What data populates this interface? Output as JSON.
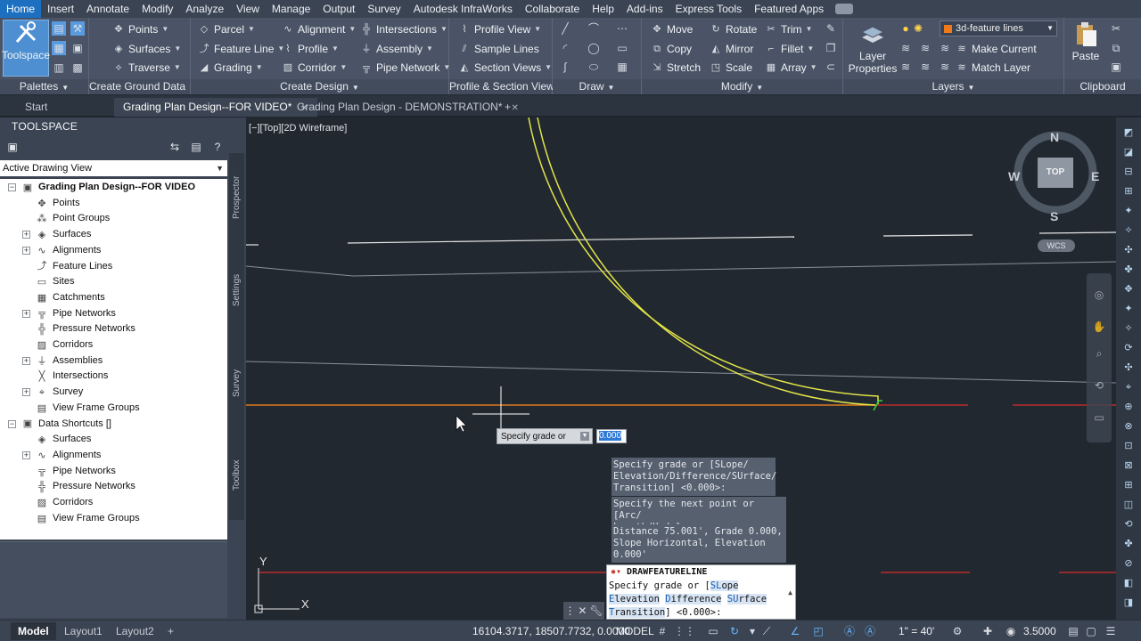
{
  "ribbon": {
    "tabs": [
      "Home",
      "Insert",
      "Annotate",
      "Modify",
      "Analyze",
      "View",
      "Manage",
      "Output",
      "Survey",
      "Autodesk InfraWorks",
      "Collaborate",
      "Help",
      "Add-ins",
      "Express Tools",
      "Featured Apps"
    ],
    "active_tab": "Home",
    "toolspace_label": "Toolspace",
    "panels": {
      "palettes": "Palettes",
      "create_ground_data": "Create Ground Data",
      "create_design": "Create Design",
      "profile_section_views": "Profile & Section Views",
      "draw": "Draw",
      "modify": "Modify",
      "layers": "Layers",
      "clipboard": "Clipboard"
    },
    "ground": {
      "points": "Points",
      "surfaces": "Surfaces",
      "traverse": "Traverse"
    },
    "design": {
      "parcel": "Parcel",
      "feature_line": "Feature Line",
      "grading": "Grading",
      "alignment": "Alignment",
      "profile": "Profile",
      "corridor": "Corridor",
      "intersections": "Intersections",
      "assembly": "Assembly",
      "pipe_network": "Pipe Network"
    },
    "views": {
      "profile_view": "Profile View",
      "sample_lines": "Sample Lines",
      "section_views": "Section Views"
    },
    "modify": {
      "move": "Move",
      "copy": "Copy",
      "stretch": "Stretch",
      "rotate": "Rotate",
      "mirror": "Mirror",
      "scale": "Scale",
      "trim": "Trim",
      "fillet": "Fillet",
      "array": "Array"
    },
    "layers": {
      "properties_line1": "Layer",
      "properties_line2": "Properties",
      "current_layer": "3d-feature lines",
      "make_current": "Make Current",
      "match_layer": "Match Layer"
    },
    "clipboard": {
      "paste": "Paste"
    }
  },
  "doc_tabs": {
    "start": "Start",
    "tabs": [
      {
        "label": "Grading Plan Design--FOR VIDEO*",
        "active": true
      },
      {
        "label": "Grading Plan Design - DEMONSTRATION*",
        "active": false
      }
    ],
    "new_tab": "+"
  },
  "toolspace": {
    "title": "TOOLSPACE",
    "view_select": "Active Drawing View",
    "tree": [
      {
        "label": "Grading Plan Design--FOR VIDEO",
        "level": 0,
        "root": true,
        "expanded": true,
        "icon": "drawing-icon"
      },
      {
        "label": "Points",
        "level": 1,
        "icon": "points-icon"
      },
      {
        "label": "Point Groups",
        "level": 1,
        "icon": "point-groups-icon"
      },
      {
        "label": "Surfaces",
        "level": 1,
        "expandable": true,
        "icon": "surfaces-icon"
      },
      {
        "label": "Alignments",
        "level": 1,
        "expandable": true,
        "icon": "alignments-icon"
      },
      {
        "label": "Feature Lines",
        "level": 1,
        "icon": "feature-lines-icon"
      },
      {
        "label": "Sites",
        "level": 1,
        "icon": "sites-icon"
      },
      {
        "label": "Catchments",
        "level": 1,
        "icon": "catchments-icon"
      },
      {
        "label": "Pipe Networks",
        "level": 1,
        "expandable": true,
        "icon": "pipe-networks-icon"
      },
      {
        "label": "Pressure Networks",
        "level": 1,
        "icon": "pressure-networks-icon"
      },
      {
        "label": "Corridors",
        "level": 1,
        "icon": "corridors-icon"
      },
      {
        "label": "Assemblies",
        "level": 1,
        "expandable": true,
        "icon": "assemblies-icon"
      },
      {
        "label": "Intersections",
        "level": 1,
        "icon": "intersections-icon"
      },
      {
        "label": "Survey",
        "level": 1,
        "expandable": true,
        "icon": "survey-icon"
      },
      {
        "label": "View Frame Groups",
        "level": 1,
        "icon": "view-frame-groups-icon"
      },
      {
        "label": "Data Shortcuts []",
        "level": 0,
        "root": false,
        "expanded": true,
        "icon": "data-shortcuts-icon"
      },
      {
        "label": "Surfaces",
        "level": 1,
        "icon": "surfaces-icon"
      },
      {
        "label": "Alignments",
        "level": 1,
        "expandable": true,
        "icon": "alignments-icon"
      },
      {
        "label": "Pipe Networks",
        "level": 1,
        "icon": "pipe-networks-icon"
      },
      {
        "label": "Pressure Networks",
        "level": 1,
        "icon": "pressure-networks-icon"
      },
      {
        "label": "Corridors",
        "level": 1,
        "icon": "corridors-icon"
      },
      {
        "label": "View Frame Groups",
        "level": 1,
        "icon": "view-frame-groups-icon"
      }
    ],
    "side_tabs": [
      "Prospector",
      "Settings",
      "Survey",
      "Toolbox"
    ]
  },
  "viewport": {
    "label": "[−][Top][2D Wireframe]",
    "compass": {
      "n": "N",
      "s": "S",
      "e": "E",
      "w": "W",
      "cube": "TOP"
    },
    "wcs": "WCS",
    "ucs": {
      "x": "X",
      "y": "Y"
    },
    "dynamic_input": {
      "prompt": "Specify grade or",
      "value": "0.000"
    },
    "history": [
      "Specify grade or [SLope/\nElevation/Difference/SUrface/\nTransition] <0.000>:",
      "Specify the next point or [Arc/\nLength/Undo]:",
      "Distance 75.001',  Grade 0.000,\nSlope Horizontal,  Elevation\n0.000'"
    ],
    "command_line": {
      "command": "DRAWFEATURELINE",
      "line1": "Specify grade or [",
      "opt_slope": "SL",
      "opt_slope_rest": "ope",
      "opt_elev": "E",
      "opt_elev_rest": "levation",
      "opt_diff": "D",
      "opt_diff_rest": "ifference",
      "opt_surf": "SU",
      "opt_surf_rest": "rface",
      "opt_trans": "T",
      "opt_trans_rest": "ransition",
      "line3_tail": "] <0.000>:"
    },
    "colors": {
      "feature_line": "#e3e548",
      "red_line": "#d92b2b",
      "orange_line": "#e07a1f",
      "white_line": "#e6e6e6",
      "gray_line": "#8a919b"
    }
  },
  "status_bar": {
    "layouts": [
      "Model",
      "Layout1",
      "Layout2"
    ],
    "add_layout": "+",
    "coordinates": "16104.3717, 18507.7732, 0.0000",
    "space": "MODEL",
    "scale": "1\" = 40'",
    "value": "3.5000"
  }
}
